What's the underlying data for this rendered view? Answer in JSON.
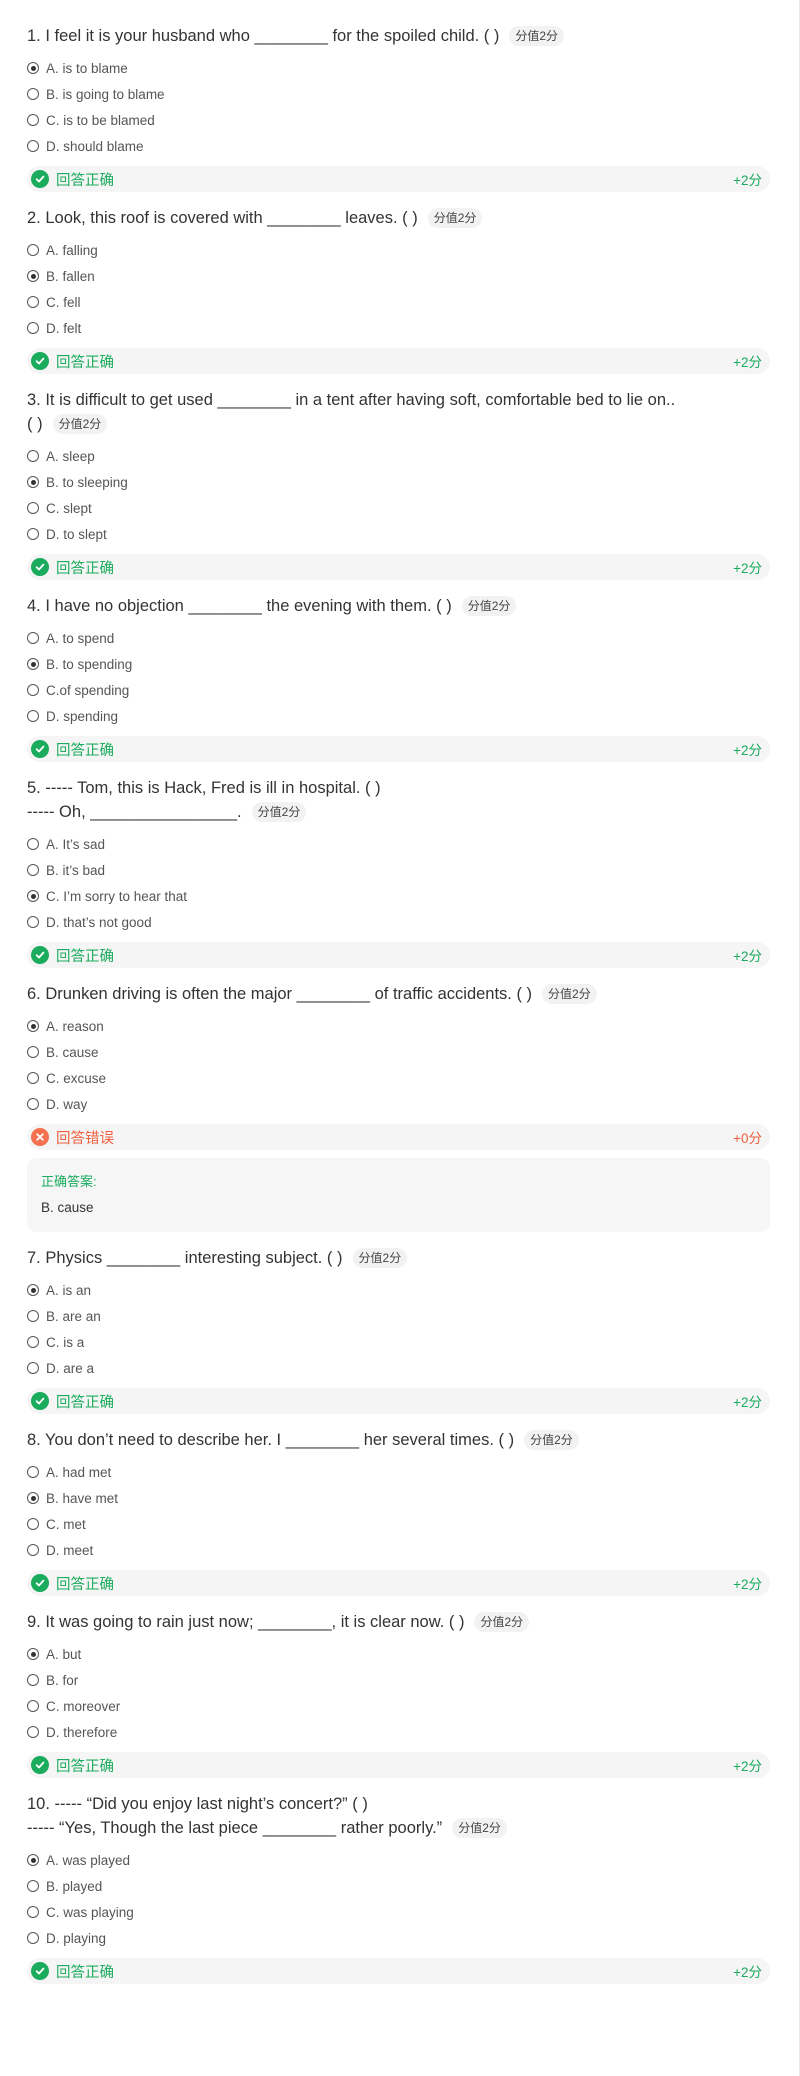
{
  "questions": [
    {
      "lines": [
        "1. I feel it is your husband who ________ for the spoiled child.  ( )"
      ],
      "score": "分值2分",
      "options": [
        "A. is to blame",
        "B. is going to blame",
        "C. is to be blamed",
        "D. should blame"
      ],
      "selected": 0,
      "result": "回答正确",
      "points": "+2分",
      "correct": true
    },
    {
      "lines": [
        "2. Look, this roof is covered with ________ leaves.  ( )"
      ],
      "score": "分值2分",
      "options": [
        "A. falling",
        "B. fallen",
        "C. fell",
        "D. felt"
      ],
      "selected": 1,
      "result": "回答正确",
      "points": "+2分",
      "correct": true
    },
    {
      "lines": [
        "3. It is difficult to get used ________ in a tent after having soft, comfortable bed to lie on..",
        "( )"
      ],
      "score": "分值2分",
      "options": [
        "A. sleep",
        "B. to sleeping",
        "C. slept",
        "D. to slept"
      ],
      "selected": 1,
      "result": "回答正确",
      "points": "+2分",
      "correct": true
    },
    {
      "lines": [
        "4. I have no objection ________ the evening with them.  ( )"
      ],
      "score": "分值2分",
      "options": [
        "A. to spend",
        "B. to spending",
        "C.of spending",
        "D. spending"
      ],
      "selected": 1,
      "result": "回答正确",
      "points": "+2分",
      "correct": true
    },
    {
      "lines": [
        "5. ----- Tom, this is Hack, Fred is ill in hospital.  ( )",
        "----- Oh, ________________."
      ],
      "score": "分值2分",
      "options": [
        "A. It’s sad",
        "B. it’s bad",
        "C. I’m sorry to hear that",
        "D. that’s not good"
      ],
      "selected": 2,
      "result": "回答正确",
      "points": "+2分",
      "correct": true
    },
    {
      "lines": [
        "6. Drunken driving is often the major ________ of traffic accidents.  ( )"
      ],
      "score": "分值2分",
      "options": [
        "A. reason",
        "B. cause",
        "C. excuse",
        "D. way"
      ],
      "selected": 0,
      "result": "回答错误",
      "points": "+0分",
      "correct": false,
      "answer_label": "正确答案:",
      "answer_text": "B. cause"
    },
    {
      "lines": [
        "7. Physics ________ interesting subject.  ( )"
      ],
      "score": "分值2分",
      "options": [
        "A. is an",
        "B. are an",
        "C. is a",
        "D. are a"
      ],
      "selected": 0,
      "result": "回答正确",
      "points": "+2分",
      "correct": true
    },
    {
      "lines": [
        "8. You don’t need to describe her. I ________ her several times.  ( )"
      ],
      "score": "分值2分",
      "options": [
        "A. had met",
        "B. have met",
        "C. met",
        "D. meet"
      ],
      "selected": 1,
      "result": "回答正确",
      "points": "+2分",
      "correct": true
    },
    {
      "lines": [
        "9. It was going to rain just now; ________, it is clear now.  ( )"
      ],
      "score": "分值2分",
      "options": [
        "A. but",
        "B. for",
        "C. moreover",
        "D. therefore"
      ],
      "selected": 0,
      "result": "回答正确",
      "points": "+2分",
      "correct": true
    },
    {
      "lines": [
        "10. ----- “Did you enjoy last night’s concert?”  ( )",
        "----- “Yes, Though the last piece ________ rather poorly.”"
      ],
      "score": "分值2分",
      "options": [
        "A. was played",
        "B. played",
        "C. was playing",
        "D. playing"
      ],
      "selected": 0,
      "result": "回答正确",
      "points": "+2分",
      "correct": true
    }
  ],
  "colors": {
    "correct": "#1aab5c",
    "wrong": "#f0603f",
    "result_bg": "#f5f5f5"
  },
  "icons": {
    "correct": "check-circle-icon",
    "wrong": "cross-circle-icon"
  }
}
